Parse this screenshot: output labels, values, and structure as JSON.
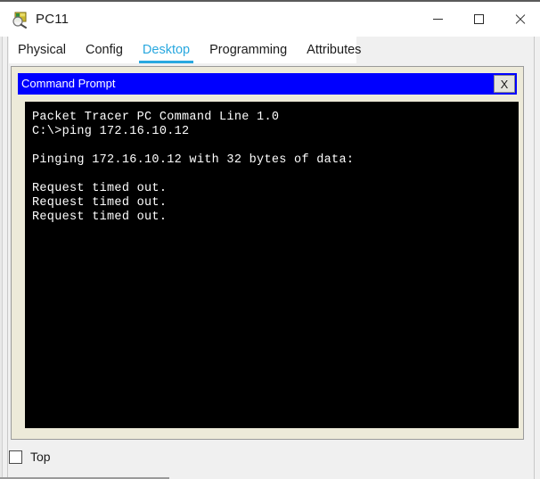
{
  "window": {
    "title": "PC11",
    "icon": "packet-tracer-pc-icon",
    "controls": {
      "minimize": "—",
      "maximize": "□",
      "close": "✕"
    }
  },
  "tabs": [
    {
      "label": "Physical",
      "active": false
    },
    {
      "label": "Config",
      "active": false
    },
    {
      "label": "Desktop",
      "active": true
    },
    {
      "label": "Programming",
      "active": false
    },
    {
      "label": "Attributes",
      "active": false
    }
  ],
  "app": {
    "title": "Command Prompt",
    "close_label": "X",
    "terminal": {
      "lines": [
        "Packet Tracer PC Command Line 1.0",
        "C:\\>ping 172.16.10.12",
        "",
        "Pinging 172.16.10.12 with 32 bytes of data:",
        "",
        "Request timed out.",
        "Request timed out.",
        "Request timed out."
      ],
      "text": "Packet Tracer PC Command Line 1.0\nC:\\>ping 172.16.10.12\n\nPinging 172.16.10.12 with 32 bytes of data:\n\nRequest timed out.\nRequest timed out.\nRequest timed out.",
      "command": "ping 172.16.10.12",
      "target_ip": "172.16.10.12",
      "packet_size_bytes": "32",
      "prompt": "C:\\>",
      "banner": "Packet Tracer PC Command Line 1.0"
    }
  },
  "footer": {
    "top_checkbox_label": "Top",
    "top_checkbox_checked": false
  },
  "colors": {
    "app_titlebar": "#0000FF",
    "active_tab": "#29A8DF",
    "desktop_panel": "#EDEAD9",
    "terminal_bg": "#000000",
    "terminal_fg": "#FFFFFF",
    "window_bg": "#F0F0F0",
    "titlebar_bg": "#FFFFFF"
  }
}
